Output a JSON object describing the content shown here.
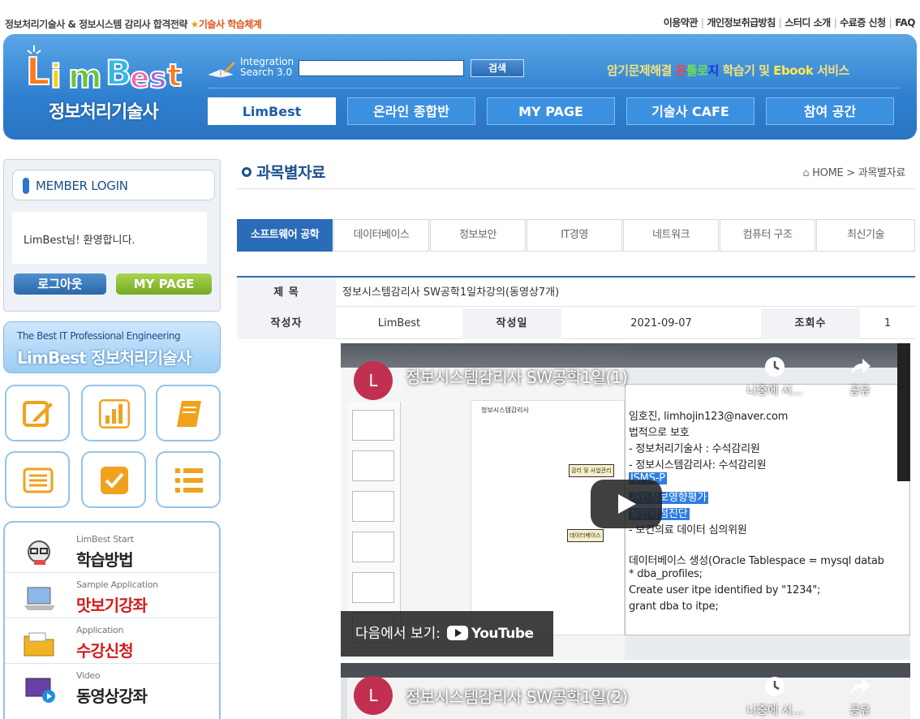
{
  "top": {
    "slogan_main": "정보처리기술사 & 정보시스템 감리사  합격전략",
    "slogan_highlight": "기술사 학습체계",
    "links": [
      "이용약관",
      "개인정보취급방침",
      "스터디 소개",
      "수료증 신청",
      "FAQ"
    ]
  },
  "header": {
    "logo_text": "LimBest",
    "logo_sub": "정보처리기술사",
    "search_label_1": "Integration",
    "search_label_2": "Search 3.0",
    "search_value": "",
    "search_button": "검색",
    "promo_1": "암기문제해결 ",
    "promo_on": "온",
    "promo_to": "톨",
    "promo_ro": "로",
    "promo_ji": "지",
    "promo_2": " 학습기 및 ",
    "promo_ebook": "Ebook",
    "promo_3": " 서비스",
    "nav": [
      "LimBest",
      "온라인 종합반",
      "MY PAGE",
      "기술사 CAFE",
      "참여 공간"
    ]
  },
  "sidebar": {
    "login_title": "MEMBER LOGIN",
    "welcome": "LimBest님! 환영합니다.",
    "logout": "로그아웃",
    "mypage": "MY PAGE",
    "banner_line1": "The Best IT Professional Engineering",
    "banner_line2": "LimBest 정보처리기술사",
    "learn": [
      {
        "small": "LimBest Start",
        "big": "학습방법",
        "color": "#222222"
      },
      {
        "small": "Sample Application",
        "big": "맛보기강좌",
        "color": "#d61b1b"
      },
      {
        "small": "Application",
        "big": "수강신청",
        "color": "#d61b1b"
      },
      {
        "small": "Video",
        "big": "동영상강좌",
        "color": "#222222"
      }
    ]
  },
  "main": {
    "title": "과목별자료",
    "breadcrumb_home": "HOME",
    "breadcrumb_current": "과목별자료",
    "tabs": [
      "소프트웨어 공학",
      "데이터베이스",
      "정보보안",
      "IT경영",
      "네트워크",
      "컴퓨터 구조",
      "최신기술"
    ],
    "post": {
      "subject_label": "제 목",
      "subject": "정보시스템감리사 SW공학1일차강의(동영상7개)",
      "author_label": "작성자",
      "author": "LimBest",
      "date_label": "작성일",
      "date": "2021-09-07",
      "views_label": "조회수",
      "views": "1"
    },
    "video1": {
      "avatar": "L",
      "title": "정보시스템감리사 SW공학1일(1)",
      "later": "나중에 시...",
      "share": "공유",
      "watch_on": "다음에서 보기:",
      "youtube": "YouTube",
      "panel_lines": [
        "임호진, limhojin123@naver.com",
        "법적으로 보호",
        "- 정보처리기술사 : 수석감리원",
        "- 정보시스템감리사: 수석감리원",
        "ISMS-P",
        "개인정보영향평가",
        "보안약점진단",
        "- 보건의료 데이터 심의위원",
        "데이터베이스 생성(Oracle Tablespace = mysql datab",
        "* dba_profiles;",
        "Create user itpe identified by \"1234\";",
        "grant dba to itpe;"
      ],
      "slide_title": "정보시스템감리사",
      "slide_box1": "감리 및 사업관리",
      "slide_box2": "데이터베이스"
    },
    "video2": {
      "avatar": "L",
      "title": "정보시스템감리사 SW공학1일(2)",
      "later": "나중에 시...",
      "share": "공유"
    }
  }
}
